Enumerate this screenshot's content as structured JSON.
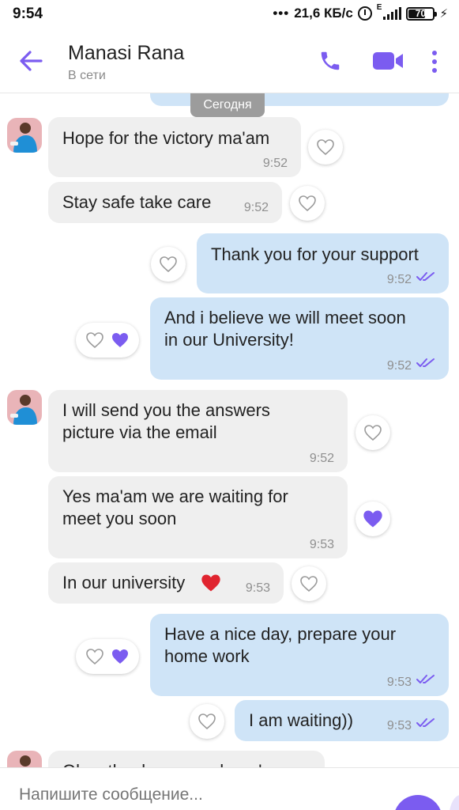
{
  "statusbar": {
    "time": "9:54",
    "dots": "•••",
    "speed": "21,6 КБ/с",
    "network_type": "E",
    "battery": "70",
    "battery_level_pct": 70
  },
  "header": {
    "contact_name": "Manasi Rana",
    "contact_status": "В сети"
  },
  "chat": {
    "date_chip": "Сегодня",
    "messages": [
      {
        "dir": "in",
        "text": "Hope for the victory ma'am",
        "time": "9:52",
        "liked": false
      },
      {
        "dir": "in",
        "text": "Stay safe take care",
        "time": "9:52",
        "liked": false
      },
      {
        "dir": "out",
        "text": "Thank you for your support",
        "time": "9:52",
        "liked": false
      },
      {
        "dir": "out",
        "line1": "And i believe we will meet soon",
        "line2": "in our University!",
        "time": "9:52",
        "liked": true
      },
      {
        "dir": "in",
        "line1": "I will send you the answers",
        "line2": "picture via the email",
        "time": "9:52",
        "liked": false
      },
      {
        "dir": "in",
        "line1": "Yes ma'am we are waiting for",
        "line2": "meet you soon",
        "time": "9:53",
        "liked": true
      },
      {
        "dir": "in",
        "text": "In our university",
        "time": "9:53",
        "liked": false
      },
      {
        "dir": "out",
        "line1": "Have a nice day, prepare your",
        "line2": "home work",
        "time": "9:53",
        "liked": true
      },
      {
        "dir": "out",
        "text": "I am waiting))",
        "time": "9:53",
        "liked": false
      },
      {
        "dir": "in",
        "text": "Okay thanks so much ma'am",
        "time": "",
        "liked": false
      }
    ]
  },
  "input": {
    "placeholder": "Напишите сообщение..."
  },
  "colors": {
    "accent": "#7b5cf0",
    "incoming_bubble": "#efefef",
    "outgoing_bubble": "#cfe4f7",
    "heart_red": "#e0242f"
  },
  "icons": [
    "back-arrow-icon",
    "phone-icon",
    "video-camera-icon",
    "more-vertical-icon",
    "heart-outline-icon",
    "heart-filled-icon",
    "double-check-icon",
    "red-heart-emoji-icon",
    "avatar-image"
  ]
}
